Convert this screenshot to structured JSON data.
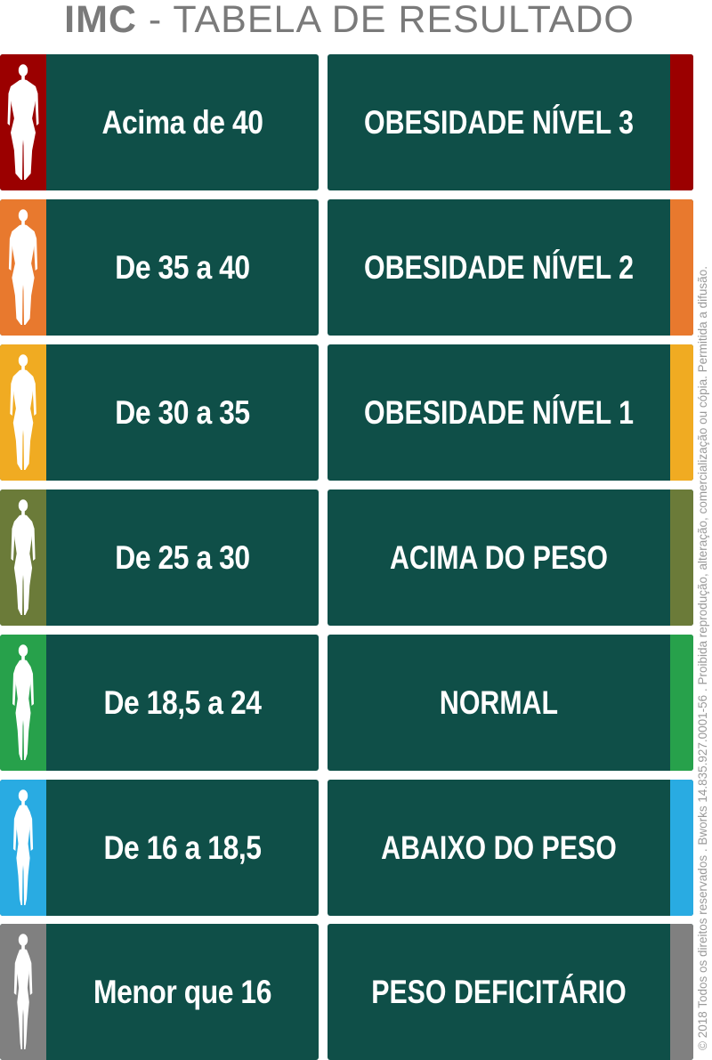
{
  "header": {
    "title_bold": "IMC",
    "title_rest": " - TABELA DE RESULTADO"
  },
  "rows": [
    {
      "range": "Acima de 40",
      "result": "OBESIDADE NÍVEL 3",
      "color": "#9b0000",
      "icon": "obese-body-icon"
    },
    {
      "range": "De 35 a 40",
      "result": "OBESIDADE NÍVEL 2",
      "color": "#e8792e",
      "icon": "obese-body-icon"
    },
    {
      "range": "De 30 a 35",
      "result": "OBESIDADE NÍVEL 1",
      "color": "#f0ab22",
      "icon": "heavy-body-icon"
    },
    {
      "range": "De 25 a 30",
      "result": "ACIMA DO PESO",
      "color": "#6b7b39",
      "icon": "overweight-body-icon"
    },
    {
      "range": "De 18,5 a 24",
      "result": "NORMAL",
      "color": "#27a14b",
      "icon": "normal-body-icon"
    },
    {
      "range": "De 16 a 18,5",
      "result": "ABAIXO DO PESO",
      "color": "#29abe2",
      "icon": "slim-body-icon"
    },
    {
      "range": "Menor que 16",
      "result": "PESO DEFICITÁRIO",
      "color": "#808080",
      "icon": "thin-body-icon"
    }
  ],
  "footer": {
    "copyright": "© 2018 Todos os direitos reservados . Bworks 14.835.927.0001-56 . Proibida reprodução, alteração, comercialização ou cópia. Permitida a difusão."
  }
}
